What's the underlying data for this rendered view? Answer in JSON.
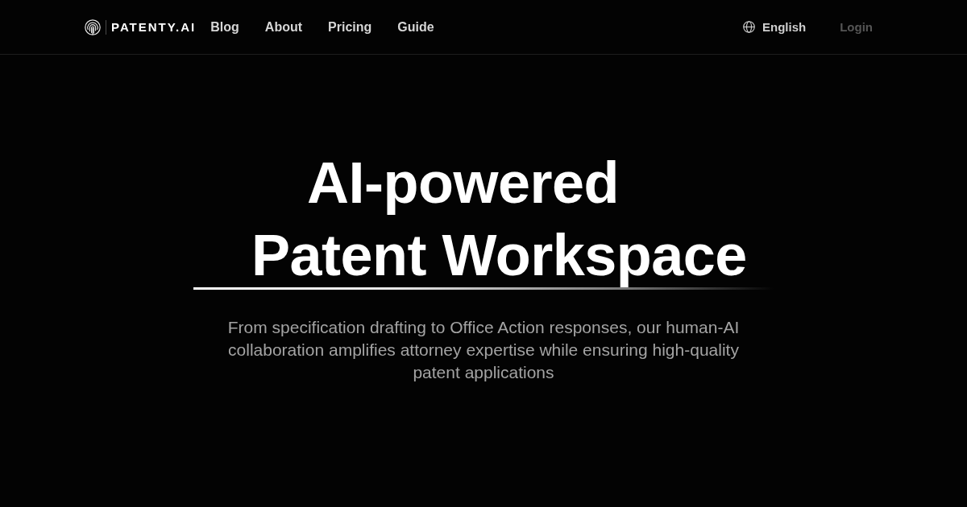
{
  "header": {
    "logo": {
      "text": "PATENTY.AI"
    },
    "nav": [
      "Blog",
      "About",
      "Pricing",
      "Guide"
    ],
    "language": {
      "label": "English"
    },
    "login": {
      "label": "Login"
    }
  },
  "hero": {
    "headline_lines": [
      "AI-powered",
      "Patent Workspace"
    ],
    "subtitle": "From specification drafting to Office Action responses, our human-AI collaboration amplifies attorney expertise while ensuring high-quality patent applications"
  }
}
